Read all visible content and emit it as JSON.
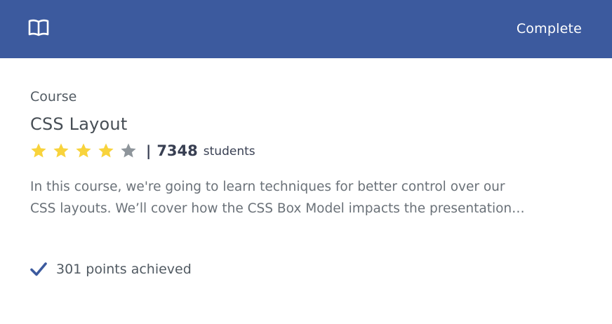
{
  "header": {
    "icon": "book-icon",
    "status": "Complete",
    "background_color": "#3c5a9e"
  },
  "course": {
    "category": "Course",
    "title": "CSS Layout",
    "rating": {
      "filled_stars": 4,
      "total_stars": 5,
      "filled_color": "#f8d33c",
      "empty_color": "#8e959b"
    },
    "separator": "|",
    "students_count": "7348",
    "students_label": "students",
    "description_lines": [
      "In this course, we're going to learn techniques for better control over our",
      "CSS layouts. We’ll cover how the CSS Box Model impacts the presentation…"
    ]
  },
  "footer": {
    "icon": "checkmark-icon",
    "points_text": "301 points achieved",
    "check_color": "#3c5a9e"
  }
}
